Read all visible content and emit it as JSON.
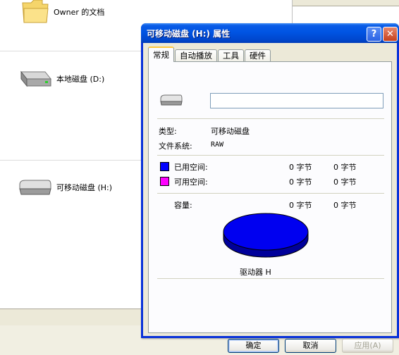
{
  "explorer": {
    "items": [
      {
        "label": "Owner 的文档",
        "icon": "folder-icon"
      },
      {
        "label": "本地磁盘 (D:)",
        "icon": "local-disk-icon"
      },
      {
        "label": "可移动磁盘 (H:)",
        "icon": "removable-disk-icon"
      }
    ]
  },
  "dialog": {
    "title": "可移动磁盘 (H:) 属性",
    "help_glyph": "?",
    "close_glyph": "✕",
    "tabs": [
      {
        "label": "常规",
        "active": true
      },
      {
        "label": "自动播放",
        "active": false
      },
      {
        "label": "工具",
        "active": false
      },
      {
        "label": "硬件",
        "active": false
      }
    ],
    "general": {
      "name_value": "",
      "type_label": "类型:",
      "type_value": "可移动磁盘",
      "fs_label": "文件系统:",
      "fs_value": "RAW",
      "used_label": "已用空间:",
      "used_bytes": "0 字节",
      "used_size": "0 字节",
      "free_label": "可用空间:",
      "free_bytes": "0 字节",
      "free_size": "0 字节",
      "capacity_label": "容量:",
      "capacity_bytes": "0 字节",
      "capacity_size": "0 字节",
      "drive_label": "驱动器 H"
    },
    "colors": {
      "used": "#0000ff",
      "free": "#ff00ff",
      "pie_top": "#0000f0",
      "pie_side": "#00009a"
    },
    "buttons": {
      "ok": "确定",
      "cancel": "取消",
      "apply": "应用(A)"
    }
  }
}
